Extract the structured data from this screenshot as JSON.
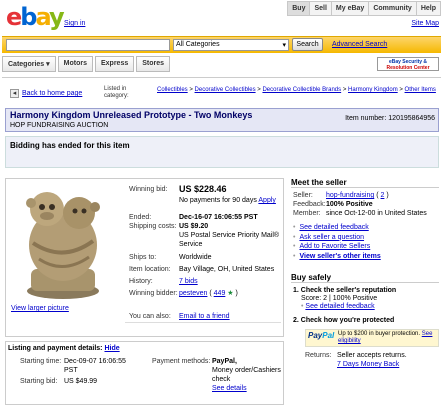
{
  "header": {
    "logo": {
      "e": "e",
      "b": "b",
      "a": "a",
      "y": "y"
    },
    "sign_in": "Sign in",
    "nav": [
      "Buy",
      "Sell",
      "My eBay",
      "Community",
      "Help"
    ],
    "site_map": "Site Map"
  },
  "search": {
    "category": "All Categories",
    "button": "Search",
    "advanced": "Advanced Search"
  },
  "catnav": [
    "Categories ▾",
    "Motors",
    "Express",
    "Stores"
  ],
  "security_center": {
    "line1": "eBay Security &",
    "line2": "Resolution Center"
  },
  "breadcrumb": {
    "back": "Back to home page",
    "listed_in": "Listed in category:",
    "path": [
      "Collectibles",
      "Decorative Collectibles",
      "Decorative Collectible Brands",
      "Harmony Kingdom",
      "Other Items"
    ]
  },
  "item": {
    "title": "Harmony Kingdom Unreleased Prototype - Two Monkeys",
    "subtitle": "HOP FUNDRAISING AUCTION",
    "item_number": "Item number: 120195864956",
    "status": "Bidding has ended for this item",
    "view_larger": "View larger picture"
  },
  "details": {
    "winning_bid_label": "Winning bid:",
    "winning_bid": "US $228.46",
    "no_payments": "No payments for 90 days",
    "apply": "Apply",
    "ended_label": "Ended:",
    "ended": "Dec-16-07 16:06:55 PST",
    "shipping_label": "Shipping costs:",
    "shipping_cost": "US $9.20",
    "shipping_service": "US Postal Service Priority Mail® Service",
    "ships_to_label": "Ships to:",
    "ships_to": "Worldwide",
    "location_label": "Item location:",
    "location": "Bay Village, OH, United States",
    "history_label": "History:",
    "history": "7 bids",
    "bidder_label": "Winning bidder:",
    "bidder": "pesteven",
    "bidder_score": "449",
    "also_label": "You can also:",
    "email_friend": "Email to a friend"
  },
  "listing": {
    "heading": "Listing and payment details:",
    "hide": "Hide",
    "start_time_label": "Starting time:",
    "start_time": "Dec-09-07 16:06:55 PST",
    "start_bid_label": "Starting bid:",
    "start_bid": "US $49.99",
    "payment_label": "Payment methods:",
    "payment_1": "PayPal,",
    "payment_2": "Money order/Cashiers check",
    "see_details": "See details"
  },
  "seller": {
    "heading": "Meet the seller",
    "seller_label": "Seller:",
    "seller_name": "hop-fundraising",
    "seller_score": "2",
    "feedback_label": "Feedback:",
    "feedback": "100% Positive",
    "member_label": "Member:",
    "member": "since Oct-12-00 in United States",
    "links": [
      "See detailed feedback",
      "Ask seller a question",
      "Add to Favorite Sellers",
      "View seller's other items"
    ]
  },
  "safety": {
    "heading": "Buy safely",
    "step1": "1. Check the seller's reputation",
    "score_line": "Score: 2 | 100% Positive",
    "see_detailed": "See detailed feedback",
    "step2": "2. Check how you're protected",
    "paypal_1": "Pay",
    "paypal_2": "Pal",
    "paypal_text": "Up to $200 in buyer protection.",
    "see_eligibility": "See eligibility",
    "returns_label": "Returns:",
    "returns": "Seller accepts returns.",
    "returns_link": "7 Days Money Back"
  },
  "colors": {
    "title_bg": "#e5e7f5",
    "search_bar": "#f5b800",
    "link": "#0000cc"
  }
}
